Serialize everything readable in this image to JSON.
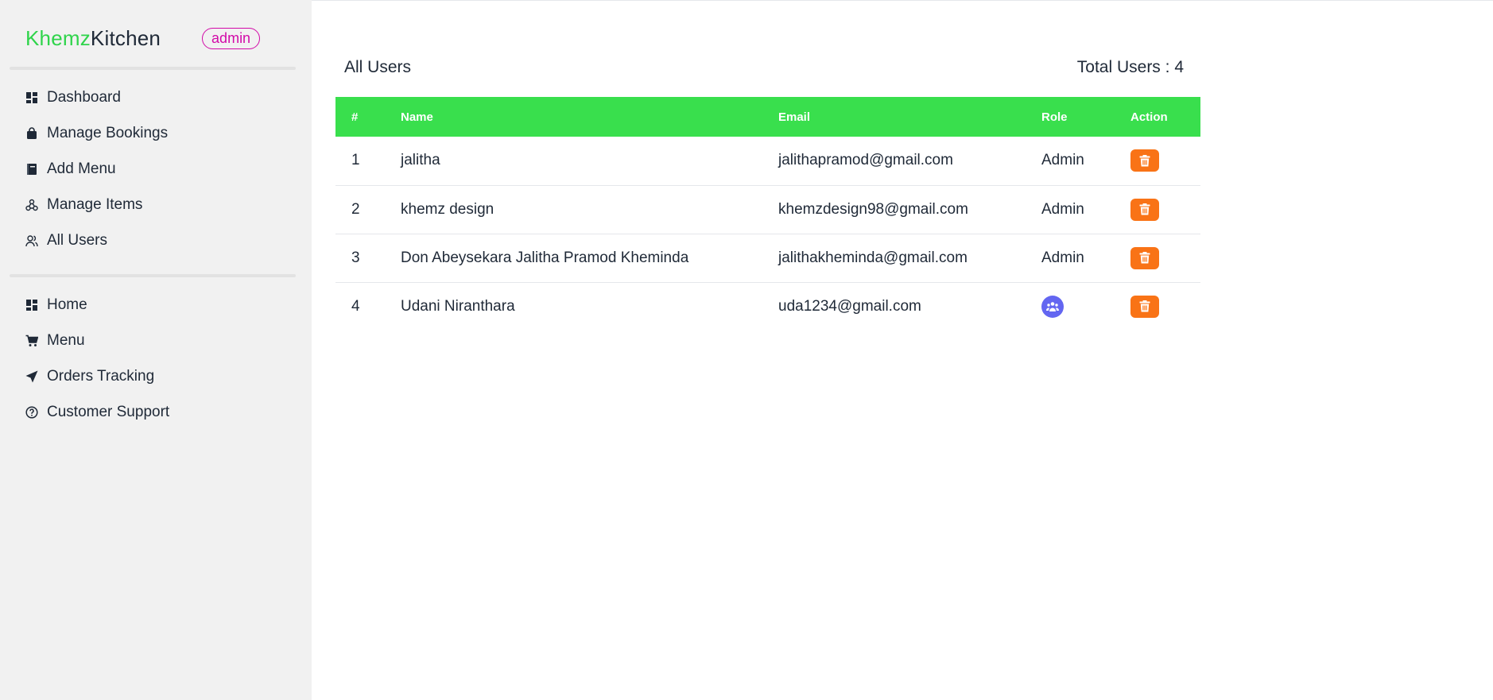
{
  "brand": {
    "part1": "Khemz",
    "part2": "Kitchen",
    "badge": "admin"
  },
  "sidebar": {
    "admin_items": [
      {
        "label": "Dashboard",
        "icon": "dashboard-icon"
      },
      {
        "label": "Manage Bookings",
        "icon": "bag-icon"
      },
      {
        "label": "Add Menu",
        "icon": "book-icon"
      },
      {
        "label": "Manage Items",
        "icon": "nodes-icon"
      },
      {
        "label": "All Users",
        "icon": "users-icon"
      }
    ],
    "site_items": [
      {
        "label": "Home",
        "icon": "dashboard-icon"
      },
      {
        "label": "Menu",
        "icon": "cart-icon"
      },
      {
        "label": "Orders Tracking",
        "icon": "paper-plane-icon"
      },
      {
        "label": "Customer Support",
        "icon": "question-circle-icon"
      }
    ]
  },
  "main": {
    "title": "All Users",
    "total_label": "Total Users : 4",
    "columns": [
      "#",
      "Name",
      "Email",
      "Role",
      "Action"
    ],
    "rows": [
      {
        "num": "1",
        "name": "jalitha",
        "email": "jalithapramod@gmail.com",
        "role": "Admin"
      },
      {
        "num": "2",
        "name": "khemz design",
        "email": "khemzdesign98@gmail.com",
        "role": "Admin"
      },
      {
        "num": "3",
        "name": "Don Abeysekara Jalitha Pramod Kheminda",
        "email": "jalithakheminda@gmail.com",
        "role": "Admin"
      },
      {
        "num": "4",
        "name": "Udani Niranthara",
        "email": "uda1234@gmail.com",
        "role": ""
      }
    ]
  },
  "colors": {
    "brand_green": "#2fd44b",
    "header_green": "#39df4d",
    "badge_magenta": "#d20aa8",
    "delete_orange": "#f97316",
    "role_purple": "#6366f1",
    "sidebar_bg": "#f1f1f1"
  }
}
